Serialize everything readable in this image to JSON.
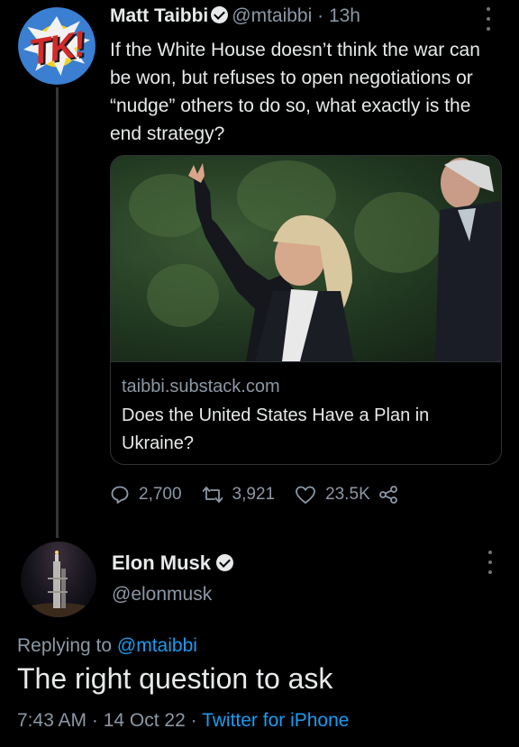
{
  "tweet1": {
    "name": "Matt Taibbi",
    "handle": "@mtaibbi",
    "time": "· 13h",
    "avatar_text": "TK!",
    "text": "If the White House doesn’t think the war can be won, but refuses to open negotiations or “nudge” others to do so, what exactly is the end strategy?",
    "card": {
      "domain": "taibbi.substack.com",
      "title": "Does the United States Have a Plan in Ukraine?"
    },
    "actions": {
      "replies": "2,700",
      "retweets": "3,921",
      "likes": "23.5K"
    }
  },
  "tweet2": {
    "name": "Elon Musk",
    "handle": "@elonmusk",
    "replying_prefix": "Replying to ",
    "replying_handle": "@mtaibbi",
    "text": "The right question to ask",
    "timestamp": "7:43 AM · 14 Oct 22 · ",
    "source": "Twitter for iPhone"
  },
  "colors": {
    "background": "#000000",
    "text": "#e7e9ea",
    "secondary": "#8b98a5",
    "link": "#1d9bf0"
  }
}
